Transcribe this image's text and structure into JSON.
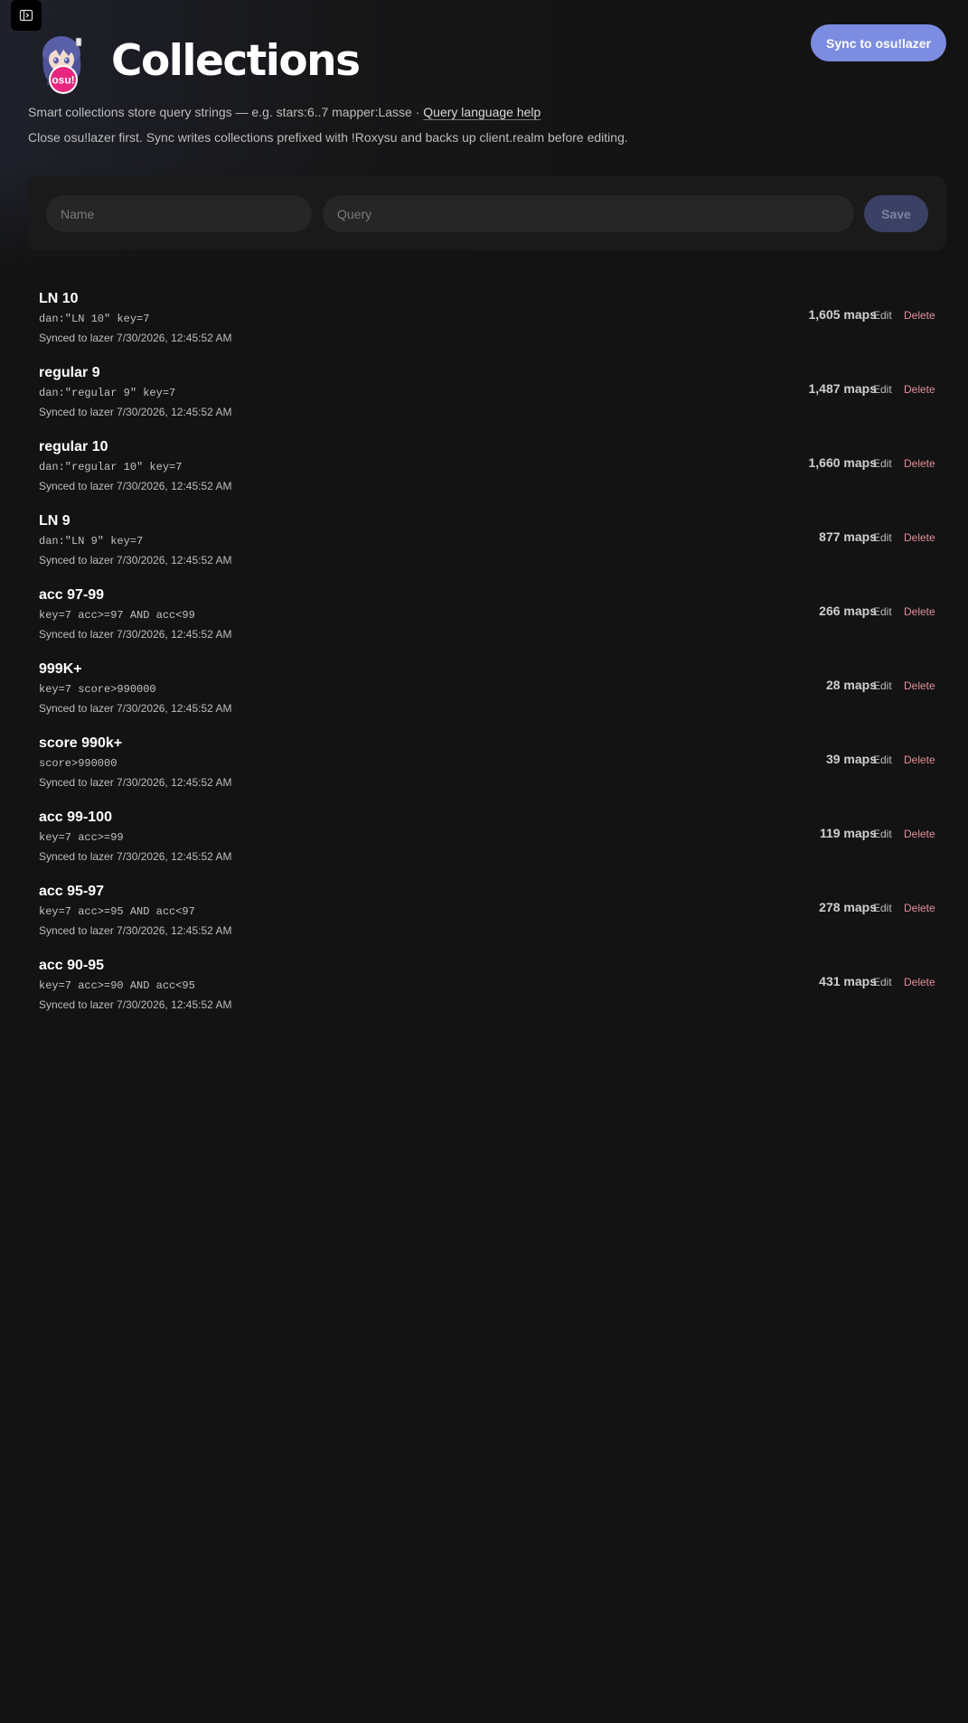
{
  "header": {
    "title": "Collections",
    "sync_button": "Sync to osu!lazer",
    "avatar_badge": "osu!"
  },
  "description": {
    "line1_prefix": "Smart collections store query strings — e.g. stars:6..7 mapper:Lasse · ",
    "help_link": "Query language help",
    "line2": "Close osu!lazer first. Sync writes collections prefixed with !Roxysu and backs up client.realm before editing."
  },
  "form": {
    "name_placeholder": "Name",
    "query_placeholder": "Query",
    "save_label": "Save"
  },
  "actions": {
    "edit_label": "Edit",
    "delete_label": "Delete"
  },
  "collections": [
    {
      "name": "LN 10",
      "query": "dan:\"LN 10\" key=7",
      "synced": "Synced to lazer 7/30/2026, 12:45:52 AM",
      "count": "1,605 maps"
    },
    {
      "name": "regular 9",
      "query": "dan:\"regular 9\" key=7",
      "synced": "Synced to lazer 7/30/2026, 12:45:52 AM",
      "count": "1,487 maps"
    },
    {
      "name": "regular 10",
      "query": "dan:\"regular 10\" key=7",
      "synced": "Synced to lazer 7/30/2026, 12:45:52 AM",
      "count": "1,660 maps"
    },
    {
      "name": "LN 9",
      "query": "dan:\"LN 9\" key=7",
      "synced": "Synced to lazer 7/30/2026, 12:45:52 AM",
      "count": "877 maps"
    },
    {
      "name": "acc 97-99",
      "query": "key=7 acc>=97 AND acc<99",
      "synced": "Synced to lazer 7/30/2026, 12:45:52 AM",
      "count": "266 maps"
    },
    {
      "name": "999K+",
      "query": "key=7 score>990000",
      "synced": "Synced to lazer 7/30/2026, 12:45:52 AM",
      "count": "28 maps"
    },
    {
      "name": "score 990k+",
      "query": "score>990000",
      "synced": "Synced to lazer 7/30/2026, 12:45:52 AM",
      "count": "39 maps"
    },
    {
      "name": "acc 99-100",
      "query": "key=7 acc>=99",
      "synced": "Synced to lazer 7/30/2026, 12:45:52 AM",
      "count": "119 maps"
    },
    {
      "name": "acc 95-97",
      "query": "key=7 acc>=95 AND acc<97",
      "synced": "Synced to lazer 7/30/2026, 12:45:52 AM",
      "count": "278 maps"
    },
    {
      "name": "acc 90-95",
      "query": "key=7 acc>=90 AND acc<95",
      "synced": "Synced to lazer 7/30/2026, 12:45:52 AM",
      "count": "431 maps"
    }
  ],
  "colors": {
    "accent": "#7c8ce0",
    "delete": "#e28f9c",
    "background": "#131313"
  }
}
